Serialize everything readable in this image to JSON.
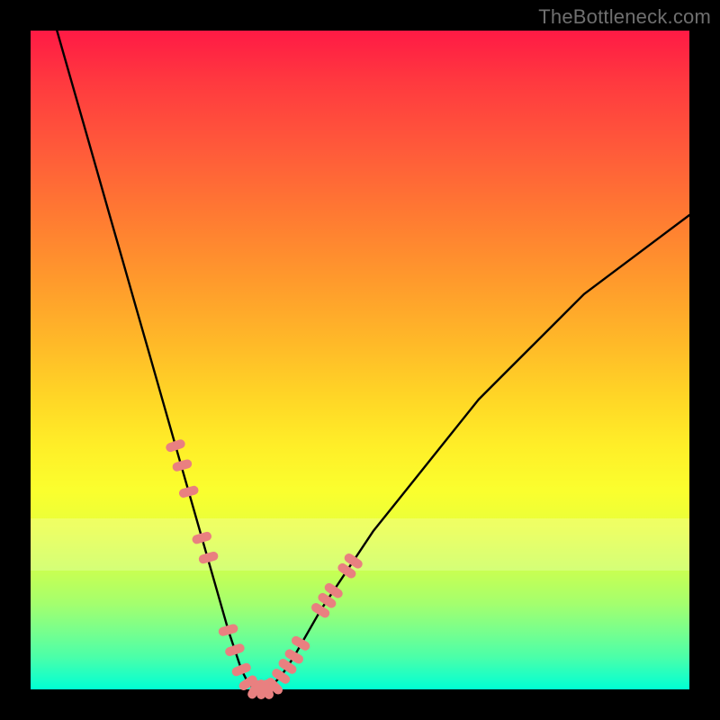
{
  "watermark": "TheBottleneck.com",
  "colors": {
    "frame": "#000000",
    "curve": "#000000",
    "marker_fill": "#e98080",
    "gradient_top": "#ff1a45",
    "gradient_bottom": "#00ffd2",
    "pale_band": "rgba(255,255,255,0.22)"
  },
  "chart_data": {
    "type": "line",
    "title": "",
    "xlabel": "",
    "ylabel": "",
    "xlim": [
      0,
      100
    ],
    "ylim": [
      0,
      100
    ],
    "grid": false,
    "legend": false,
    "series": [
      {
        "name": "bottleneck-curve",
        "x": [
          4,
          6,
          8,
          10,
          12,
          14,
          16,
          18,
          20,
          22,
          24,
          26,
          28,
          30,
          32,
          33,
          34,
          35,
          36,
          38,
          40,
          44,
          48,
          52,
          56,
          60,
          64,
          68,
          72,
          76,
          80,
          84,
          88,
          92,
          96,
          100
        ],
        "y": [
          100,
          93,
          86,
          79,
          72,
          65,
          58,
          51,
          44,
          37,
          30,
          23,
          16,
          9,
          3,
          1,
          0,
          0,
          0,
          2,
          5,
          12,
          18,
          24,
          29,
          34,
          39,
          44,
          48,
          52,
          56,
          60,
          63,
          66,
          69,
          72
        ]
      }
    ],
    "markers": {
      "name": "highlight-points",
      "shape": "rounded-rect",
      "x": [
        22,
        23,
        24,
        26,
        27,
        30,
        31,
        32,
        33,
        34,
        35,
        36,
        37,
        38,
        39,
        40,
        41,
        44,
        45,
        46,
        48,
        49
      ],
      "y": [
        37,
        34,
        30,
        23,
        20,
        9,
        6,
        3,
        1,
        0,
        0,
        0,
        0.5,
        2,
        3.5,
        5,
        7,
        12,
        13.5,
        15,
        18,
        19.5
      ]
    },
    "pale_band_y": [
      18,
      26
    ]
  }
}
